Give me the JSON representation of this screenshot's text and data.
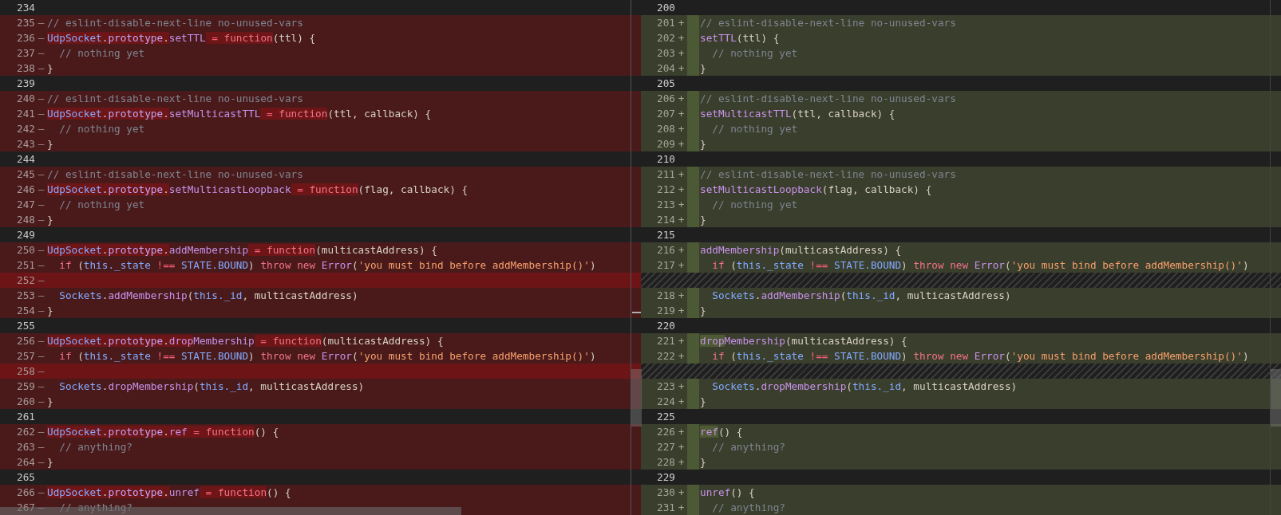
{
  "left": {
    "lines": [
      {
        "number": "234",
        "kind": "context"
      },
      {
        "number": "235",
        "kind": "removed",
        "marker": "—",
        "segments": [
          {
            "text": "// eslint-disable-next-line no-unused-vars",
            "kind": "comment",
            "changed": false
          }
        ]
      },
      {
        "number": "236",
        "kind": "removed",
        "marker": "—",
        "segments": [
          {
            "text": "UdpSocket",
            "kind": "class",
            "changed": true
          },
          {
            "text": ".",
            "kind": "plain",
            "changed": true
          },
          {
            "text": "prototype",
            "kind": "prop",
            "changed": true
          },
          {
            "text": ".",
            "kind": "plain",
            "changed": true
          },
          {
            "text": "setTTL",
            "kind": "method",
            "changed": false
          },
          {
            "text": " = ",
            "kind": "operator",
            "changed": true
          },
          {
            "text": "function",
            "kind": "keyword",
            "changed": true
          },
          {
            "text": "(ttl) {",
            "kind": "plain",
            "changed": false
          }
        ]
      },
      {
        "number": "237",
        "kind": "removed",
        "marker": "—",
        "segments": [
          {
            "text": "  // nothing yet",
            "kind": "comment",
            "changed": false
          }
        ]
      },
      {
        "number": "238",
        "kind": "removed",
        "marker": "—",
        "segments": [
          {
            "text": "}",
            "kind": "plain",
            "changed": false
          }
        ]
      },
      {
        "number": "239",
        "kind": "context"
      },
      {
        "number": "240",
        "kind": "removed",
        "marker": "—",
        "segments": [
          {
            "text": "// eslint-disable-next-line no-unused-vars",
            "kind": "comment",
            "changed": false
          }
        ]
      },
      {
        "number": "241",
        "kind": "removed",
        "marker": "—",
        "segments": [
          {
            "text": "UdpSocket",
            "kind": "class",
            "changed": true
          },
          {
            "text": ".",
            "kind": "plain",
            "changed": true
          },
          {
            "text": "prototype",
            "kind": "prop",
            "changed": true
          },
          {
            "text": ".",
            "kind": "plain",
            "changed": true
          },
          {
            "text": "setMulticastTTL",
            "kind": "method",
            "changed": false
          },
          {
            "text": " = ",
            "kind": "operator",
            "changed": true
          },
          {
            "text": "function",
            "kind": "keyword",
            "changed": true
          },
          {
            "text": "(ttl, callback) {",
            "kind": "plain",
            "changed": false
          }
        ]
      },
      {
        "number": "242",
        "kind": "removed",
        "marker": "—",
        "segments": [
          {
            "text": "  // nothing yet",
            "kind": "comment",
            "changed": false
          }
        ]
      },
      {
        "number": "243",
        "kind": "removed",
        "marker": "—",
        "segments": [
          {
            "text": "}",
            "kind": "plain",
            "changed": false
          }
        ]
      },
      {
        "number": "244",
        "kind": "context"
      },
      {
        "number": "245",
        "kind": "removed",
        "marker": "—",
        "segments": [
          {
            "text": "// eslint-disable-next-line no-unused-vars",
            "kind": "comment",
            "changed": false
          }
        ]
      },
      {
        "number": "246",
        "kind": "removed",
        "marker": "—",
        "segments": [
          {
            "text": "UdpSocket",
            "kind": "class",
            "changed": true
          },
          {
            "text": ".",
            "kind": "plain",
            "changed": true
          },
          {
            "text": "prototype",
            "kind": "prop",
            "changed": true
          },
          {
            "text": ".",
            "kind": "plain",
            "changed": true
          },
          {
            "text": "setMulticastLoopback",
            "kind": "method",
            "changed": false
          },
          {
            "text": " = ",
            "kind": "operator",
            "changed": true
          },
          {
            "text": "function",
            "kind": "keyword",
            "changed": true
          },
          {
            "text": "(flag, callback) {",
            "kind": "plain",
            "changed": false
          }
        ]
      },
      {
        "number": "247",
        "kind": "removed",
        "marker": "—",
        "segments": [
          {
            "text": "  // nothing yet",
            "kind": "comment",
            "changed": false
          }
        ]
      },
      {
        "number": "248",
        "kind": "removed",
        "marker": "—",
        "segments": [
          {
            "text": "}",
            "kind": "plain",
            "changed": false
          }
        ]
      },
      {
        "number": "249",
        "kind": "context"
      },
      {
        "number": "250",
        "kind": "removed",
        "marker": "—",
        "segments": [
          {
            "text": "UdpSocket",
            "kind": "class",
            "changed": true
          },
          {
            "text": ".",
            "kind": "plain",
            "changed": true
          },
          {
            "text": "prototype",
            "kind": "prop",
            "changed": true
          },
          {
            "text": ".",
            "kind": "plain",
            "changed": true
          },
          {
            "text": "addMembership",
            "kind": "method",
            "changed": false
          },
          {
            "text": " = ",
            "kind": "operator",
            "changed": true
          },
          {
            "text": "function",
            "kind": "keyword",
            "changed": true
          },
          {
            "text": "(multicastAddress) {",
            "kind": "plain",
            "changed": false
          }
        ]
      },
      {
        "number": "251",
        "kind": "removed",
        "marker": "—",
        "segments": [
          {
            "text": "  if",
            "kind": "keyword",
            "changed": false
          },
          {
            "text": " (",
            "kind": "plain",
            "changed": false
          },
          {
            "text": "this._state",
            "kind": "variable",
            "changed": false
          },
          {
            "text": " !== ",
            "kind": "operator",
            "changed": false
          },
          {
            "text": "STATE.BOUND",
            "kind": "variable",
            "changed": false
          },
          {
            "text": ") ",
            "kind": "plain",
            "changed": false
          },
          {
            "text": "throw new ",
            "kind": "keyword",
            "changed": false
          },
          {
            "text": "Error",
            "kind": "method",
            "changed": false
          },
          {
            "text": "(",
            "kind": "plain",
            "changed": false
          },
          {
            "text": "'you must bind before addMembership()'",
            "kind": "string",
            "changed": false
          },
          {
            "text": ")",
            "kind": "plain",
            "changed": false
          }
        ]
      },
      {
        "number": "252",
        "kind": "removed_blank",
        "marker": "—"
      },
      {
        "number": "253",
        "kind": "removed",
        "marker": "—",
        "segments": [
          {
            "text": "  Sockets",
            "kind": "variable",
            "changed": false
          },
          {
            "text": ".",
            "kind": "plain",
            "changed": false
          },
          {
            "text": "addMembership",
            "kind": "method",
            "changed": false
          },
          {
            "text": "(",
            "kind": "plain",
            "changed": false
          },
          {
            "text": "this._id",
            "kind": "variable",
            "changed": false
          },
          {
            "text": ", multicastAddress)",
            "kind": "plain",
            "changed": false
          }
        ]
      },
      {
        "number": "254",
        "kind": "removed",
        "marker": "—",
        "segments": [
          {
            "text": "}",
            "kind": "plain",
            "changed": false
          }
        ]
      },
      {
        "number": "255",
        "kind": "context"
      },
      {
        "number": "256",
        "kind": "removed",
        "marker": "—",
        "segments": [
          {
            "text": "UdpSocket",
            "kind": "class",
            "changed": true
          },
          {
            "text": ".",
            "kind": "plain",
            "changed": true
          },
          {
            "text": "prototype",
            "kind": "prop",
            "changed": true
          },
          {
            "text": ".",
            "kind": "plain",
            "changed": true
          },
          {
            "text": "drop",
            "kind": "method",
            "changed": true
          },
          {
            "text": "Membership",
            "kind": "method",
            "changed": false
          },
          {
            "text": " = ",
            "kind": "operator",
            "changed": true
          },
          {
            "text": "function",
            "kind": "keyword",
            "changed": true
          },
          {
            "text": "(multicastAddress) {",
            "kind": "plain",
            "changed": false
          }
        ]
      },
      {
        "number": "257",
        "kind": "removed",
        "marker": "—",
        "segments": [
          {
            "text": "  if",
            "kind": "keyword",
            "changed": false
          },
          {
            "text": " (",
            "kind": "plain",
            "changed": false
          },
          {
            "text": "this._state",
            "kind": "variable",
            "changed": false
          },
          {
            "text": " !== ",
            "kind": "operator",
            "changed": false
          },
          {
            "text": "STATE.BOUND",
            "kind": "variable",
            "changed": false
          },
          {
            "text": ") ",
            "kind": "plain",
            "changed": false
          },
          {
            "text": "throw new ",
            "kind": "keyword",
            "changed": false
          },
          {
            "text": "Error",
            "kind": "method",
            "changed": false
          },
          {
            "text": "(",
            "kind": "plain",
            "changed": false
          },
          {
            "text": "'you must bind before addMembership()'",
            "kind": "string",
            "changed": false
          },
          {
            "text": ")",
            "kind": "plain",
            "changed": false
          }
        ]
      },
      {
        "number": "258",
        "kind": "removed_blank",
        "marker": "—"
      },
      {
        "number": "259",
        "kind": "removed",
        "marker": "—",
        "segments": [
          {
            "text": "  Sockets",
            "kind": "variable",
            "changed": false
          },
          {
            "text": ".",
            "kind": "plain",
            "changed": false
          },
          {
            "text": "dropMembership",
            "kind": "method",
            "changed": false
          },
          {
            "text": "(",
            "kind": "plain",
            "changed": false
          },
          {
            "text": "this._id",
            "kind": "variable",
            "changed": false
          },
          {
            "text": ", multicastAddress)",
            "kind": "plain",
            "changed": false
          }
        ]
      },
      {
        "number": "260",
        "kind": "removed",
        "marker": "—",
        "segments": [
          {
            "text": "}",
            "kind": "plain",
            "changed": false
          }
        ]
      },
      {
        "number": "261",
        "kind": "context"
      },
      {
        "number": "262",
        "kind": "removed",
        "marker": "—",
        "segments": [
          {
            "text": "UdpSocket",
            "kind": "class",
            "changed": true
          },
          {
            "text": ".",
            "kind": "plain",
            "changed": true
          },
          {
            "text": "prototype",
            "kind": "prop",
            "changed": true
          },
          {
            "text": ".",
            "kind": "plain",
            "changed": true
          },
          {
            "text": "ref",
            "kind": "method",
            "changed": true
          },
          {
            "text": " = ",
            "kind": "operator",
            "changed": true
          },
          {
            "text": "function",
            "kind": "keyword",
            "changed": true
          },
          {
            "text": "() {",
            "kind": "plain",
            "changed": false
          }
        ]
      },
      {
        "number": "263",
        "kind": "removed",
        "marker": "—",
        "segments": [
          {
            "text": "  // anything?",
            "kind": "comment",
            "changed": false
          }
        ]
      },
      {
        "number": "264",
        "kind": "removed",
        "marker": "—",
        "segments": [
          {
            "text": "}",
            "kind": "plain",
            "changed": false
          }
        ]
      },
      {
        "number": "265",
        "kind": "context"
      },
      {
        "number": "266",
        "kind": "removed",
        "marker": "—",
        "segments": [
          {
            "text": "UdpSocket",
            "kind": "class",
            "changed": true
          },
          {
            "text": ".",
            "kind": "plain",
            "changed": true
          },
          {
            "text": "prototype",
            "kind": "prop",
            "changed": true
          },
          {
            "text": ".",
            "kind": "plain",
            "changed": true
          },
          {
            "text": "unref",
            "kind": "method",
            "changed": false
          },
          {
            "text": " = ",
            "kind": "operator",
            "changed": true
          },
          {
            "text": "function",
            "kind": "keyword",
            "changed": true
          },
          {
            "text": "() {",
            "kind": "plain",
            "changed": false
          }
        ]
      },
      {
        "number": "267",
        "kind": "removed",
        "marker": "—",
        "segments": [
          {
            "text": "  // anything?",
            "kind": "comment",
            "changed": false
          }
        ]
      }
    ]
  },
  "right": {
    "lines": [
      {
        "number": "200",
        "kind": "context"
      },
      {
        "number": "201",
        "kind": "added",
        "marker": "+",
        "segments": [
          {
            "text": "// eslint-disable-next-line no-unused-vars",
            "kind": "comment",
            "changed": false
          }
        ]
      },
      {
        "number": "202",
        "kind": "added",
        "marker": "+",
        "segments": [
          {
            "text": "setTTL",
            "kind": "method",
            "changed": false
          },
          {
            "text": "(ttl) {",
            "kind": "plain",
            "changed": false
          }
        ]
      },
      {
        "number": "203",
        "kind": "added",
        "marker": "+",
        "segments": [
          {
            "text": "  // nothing yet",
            "kind": "comment",
            "changed": false
          }
        ]
      },
      {
        "number": "204",
        "kind": "added",
        "marker": "+",
        "segments": [
          {
            "text": "}",
            "kind": "plain",
            "changed": false
          }
        ]
      },
      {
        "number": "205",
        "kind": "context"
      },
      {
        "number": "206",
        "kind": "added",
        "marker": "+",
        "segments": [
          {
            "text": "// eslint-disable-next-line no-unused-vars",
            "kind": "comment",
            "changed": false
          }
        ]
      },
      {
        "number": "207",
        "kind": "added",
        "marker": "+",
        "segments": [
          {
            "text": "setMulticastTTL",
            "kind": "method",
            "changed": false
          },
          {
            "text": "(ttl, callback) {",
            "kind": "plain",
            "changed": false
          }
        ]
      },
      {
        "number": "208",
        "kind": "added",
        "marker": "+",
        "segments": [
          {
            "text": "  // nothing yet",
            "kind": "comment",
            "changed": false
          }
        ]
      },
      {
        "number": "209",
        "kind": "added",
        "marker": "+",
        "segments": [
          {
            "text": "}",
            "kind": "plain",
            "changed": false
          }
        ]
      },
      {
        "number": "210",
        "kind": "context"
      },
      {
        "number": "211",
        "kind": "added",
        "marker": "+",
        "segments": [
          {
            "text": "// eslint-disable-next-line no-unused-vars",
            "kind": "comment",
            "changed": false
          }
        ]
      },
      {
        "number": "212",
        "kind": "added",
        "marker": "+",
        "segments": [
          {
            "text": "setMulticastLoopback",
            "kind": "method",
            "changed": false
          },
          {
            "text": "(flag, callback) {",
            "kind": "plain",
            "changed": false
          }
        ]
      },
      {
        "number": "213",
        "kind": "added",
        "marker": "+",
        "segments": [
          {
            "text": "  // nothing yet",
            "kind": "comment",
            "changed": false
          }
        ]
      },
      {
        "number": "214",
        "kind": "added",
        "marker": "+",
        "segments": [
          {
            "text": "}",
            "kind": "plain",
            "changed": false
          }
        ]
      },
      {
        "number": "215",
        "kind": "context"
      },
      {
        "number": "216",
        "kind": "added",
        "marker": "+",
        "segments": [
          {
            "text": "addMembership",
            "kind": "method",
            "changed": false
          },
          {
            "text": "(multicastAddress) {",
            "kind": "plain",
            "changed": false
          }
        ]
      },
      {
        "number": "217",
        "kind": "added",
        "marker": "+",
        "segments": [
          {
            "text": "  if",
            "kind": "keyword",
            "changed": false
          },
          {
            "text": " (",
            "kind": "plain",
            "changed": false
          },
          {
            "text": "this._state",
            "kind": "variable",
            "changed": false
          },
          {
            "text": " !== ",
            "kind": "operator",
            "changed": false
          },
          {
            "text": "STATE.BOUND",
            "kind": "variable",
            "changed": false
          },
          {
            "text": ") ",
            "kind": "plain",
            "changed": false
          },
          {
            "text": "throw new ",
            "kind": "keyword",
            "changed": false
          },
          {
            "text": "Error",
            "kind": "method",
            "changed": false
          },
          {
            "text": "(",
            "kind": "plain",
            "changed": false
          },
          {
            "text": "'you must bind before addMembership()'",
            "kind": "string",
            "changed": false
          },
          {
            "text": ")",
            "kind": "plain",
            "changed": false
          }
        ]
      },
      {
        "kind": "filler"
      },
      {
        "number": "218",
        "kind": "added",
        "marker": "+",
        "segments": [
          {
            "text": "  Sockets",
            "kind": "variable",
            "changed": false
          },
          {
            "text": ".",
            "kind": "plain",
            "changed": false
          },
          {
            "text": "addMembership",
            "kind": "method",
            "changed": false
          },
          {
            "text": "(",
            "kind": "plain",
            "changed": false
          },
          {
            "text": "this._id",
            "kind": "variable",
            "changed": false
          },
          {
            "text": ", multicastAddress)",
            "kind": "plain",
            "changed": false
          }
        ]
      },
      {
        "number": "219",
        "kind": "added",
        "marker": "+",
        "segments": [
          {
            "text": "}",
            "kind": "plain",
            "changed": false
          }
        ]
      },
      {
        "number": "220",
        "kind": "context"
      },
      {
        "number": "221",
        "kind": "added",
        "marker": "+",
        "segments": [
          {
            "text": "drop",
            "kind": "method",
            "changed": true
          },
          {
            "text": "Membership",
            "kind": "method",
            "changed": false
          },
          {
            "text": "(multicastAddress) {",
            "kind": "plain",
            "changed": false
          }
        ]
      },
      {
        "number": "222",
        "kind": "added",
        "marker": "+",
        "segments": [
          {
            "text": "  if",
            "kind": "keyword",
            "changed": false
          },
          {
            "text": " (",
            "kind": "plain",
            "changed": false
          },
          {
            "text": "this._state",
            "kind": "variable",
            "changed": false
          },
          {
            "text": " !== ",
            "kind": "operator",
            "changed": false
          },
          {
            "text": "STATE.BOUND",
            "kind": "variable",
            "changed": false
          },
          {
            "text": ") ",
            "kind": "plain",
            "changed": false
          },
          {
            "text": "throw new ",
            "kind": "keyword",
            "changed": false
          },
          {
            "text": "Error",
            "kind": "method",
            "changed": false
          },
          {
            "text": "(",
            "kind": "plain",
            "changed": false
          },
          {
            "text": "'you must bind before addMembership()'",
            "kind": "string",
            "changed": false
          },
          {
            "text": ")",
            "kind": "plain",
            "changed": false
          }
        ]
      },
      {
        "kind": "filler"
      },
      {
        "number": "223",
        "kind": "added",
        "marker": "+",
        "segments": [
          {
            "text": "  Sockets",
            "kind": "variable",
            "changed": false
          },
          {
            "text": ".",
            "kind": "plain",
            "changed": false
          },
          {
            "text": "dropMembership",
            "kind": "method",
            "changed": false
          },
          {
            "text": "(",
            "kind": "plain",
            "changed": false
          },
          {
            "text": "this._id",
            "kind": "variable",
            "changed": false
          },
          {
            "text": ", multicastAddress)",
            "kind": "plain",
            "changed": false
          }
        ]
      },
      {
        "number": "224",
        "kind": "added",
        "marker": "+",
        "segments": [
          {
            "text": "}",
            "kind": "plain",
            "changed": false
          }
        ]
      },
      {
        "number": "225",
        "kind": "context"
      },
      {
        "number": "226",
        "kind": "added",
        "marker": "+",
        "segments": [
          {
            "text": "ref",
            "kind": "method",
            "changed": true
          },
          {
            "text": "() {",
            "kind": "plain",
            "changed": false
          }
        ]
      },
      {
        "number": "227",
        "kind": "added",
        "marker": "+",
        "segments": [
          {
            "text": "  // anything?",
            "kind": "comment",
            "changed": false
          }
        ]
      },
      {
        "number": "228",
        "kind": "added",
        "marker": "+",
        "segments": [
          {
            "text": "}",
            "kind": "plain",
            "changed": false
          }
        ]
      },
      {
        "number": "229",
        "kind": "context"
      },
      {
        "number": "230",
        "kind": "added",
        "marker": "+",
        "segments": [
          {
            "text": "unref",
            "kind": "method",
            "changed": false
          },
          {
            "text": "() {",
            "kind": "plain",
            "changed": false
          }
        ]
      },
      {
        "number": "231",
        "kind": "added",
        "marker": "+",
        "segments": [
          {
            "text": "  // anything?",
            "kind": "comment",
            "changed": false
          }
        ]
      }
    ]
  }
}
